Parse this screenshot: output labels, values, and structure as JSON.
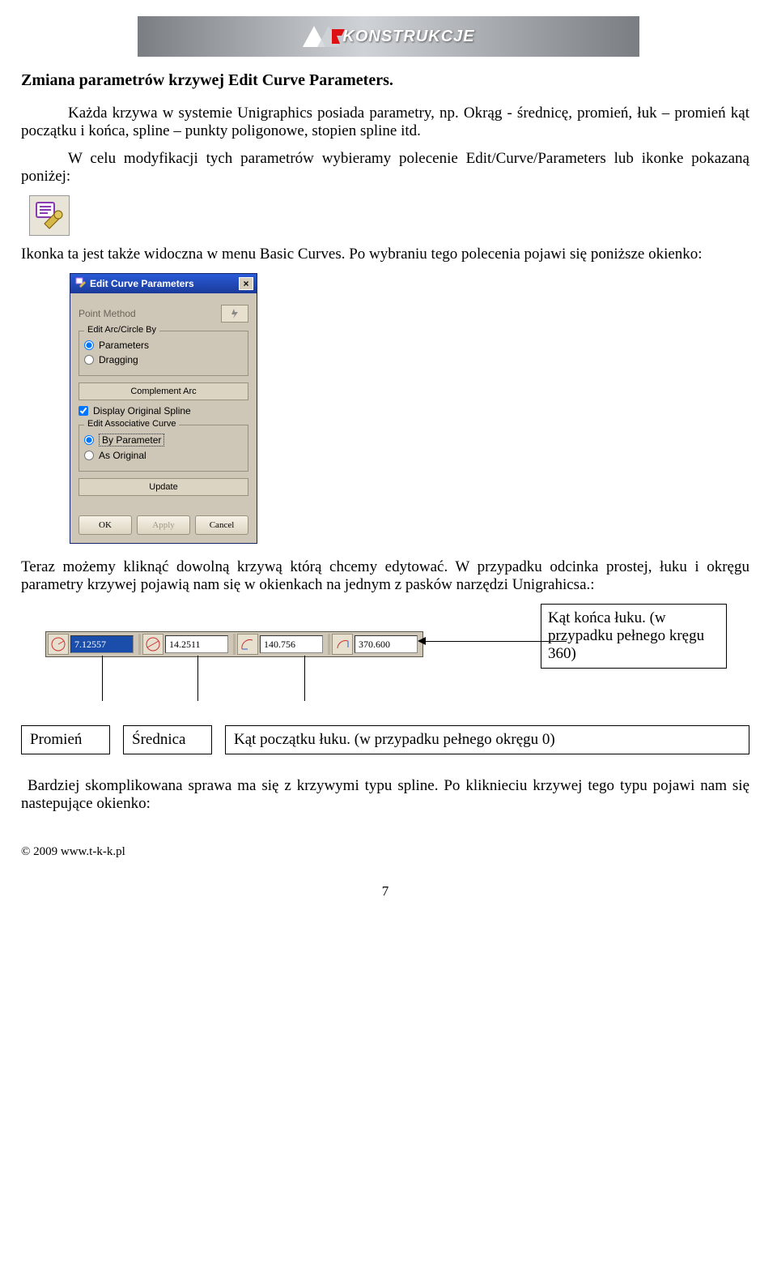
{
  "banner": {
    "brand": "KONSTRUKCJE"
  },
  "heading": "Zmiana parametrów krzywej Edit Curve Parameters.",
  "p1": "Każda krzywa w systemie Unigraphics posiada parametry, np. Okrąg - średnicę, promień, łuk – promień kąt początku i końca, spline – punkty poligonowe, stopien spline itd.",
  "p2": "W celu modyfikacji tych parametrów wybieramy polecenie Edit/Curve/Parameters lub ikonke pokazaną poniżej:",
  "p3": "Ikonka ta jest także widoczna w menu Basic Curves. Po wybraniu tego polecenia pojawi się poniższe okienko:",
  "p4": "Teraz możemy kliknąć dowolną krzywą którą chcemy edytować. W przypadku odcinka prostej, łuku i okręgu parametry krzywej pojawią nam się w okienkach na jednym z pasków narzędzi Unigrahicsa.:",
  "p5": "Bardziej skomplikowana sprawa ma się z krzywymi typu spline. Po kliknieciu krzywej tego typu pojawi nam się nastepujące okienko:",
  "dialog": {
    "title": "Edit Curve Parameters",
    "point_method": "Point Method",
    "group1": {
      "title": "Edit Arc/Circle By",
      "opt1": "Parameters",
      "opt2": "Dragging"
    },
    "complement": "Complement Arc",
    "display_original": "Display Original Spline",
    "group2": {
      "title": "Edit Associative Curve",
      "opt1": "By Parameter",
      "opt2": "As Original"
    },
    "update": "Update",
    "ok": "OK",
    "apply": "Apply",
    "cancel": "Cancel"
  },
  "toolbar": {
    "radius": "7.12557",
    "diameter": "14.2511",
    "start_angle": "140.756",
    "end_angle": "370.600"
  },
  "callouts": {
    "end_angle": "Kąt końca łuku. (w przypadku pełnego kręgu 360)",
    "radius": "Promień",
    "diameter": "Średnica",
    "start_angle": "Kąt początku łuku. (w przypadku pełnego okręgu 0)"
  },
  "footer": "© 2009 www.t-k-k.pl",
  "page_number": "7"
}
